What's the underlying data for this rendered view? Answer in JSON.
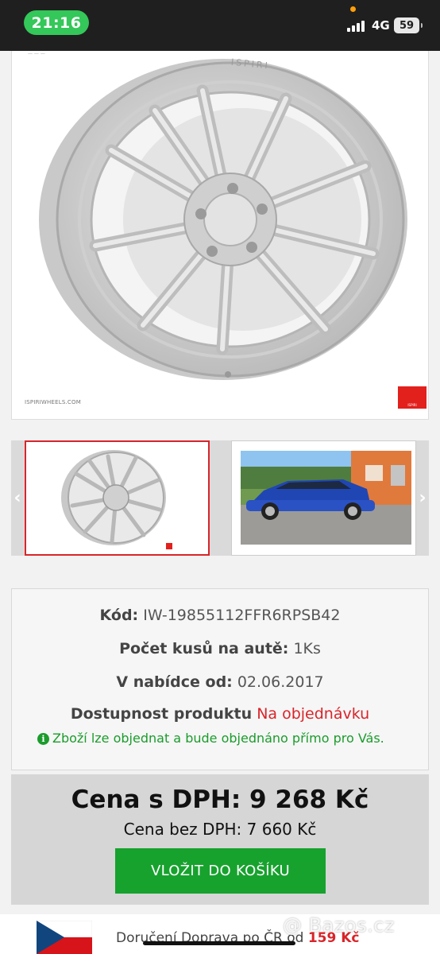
{
  "status": {
    "time": "21:16",
    "network": "4G",
    "battery": "59"
  },
  "product": {
    "image_brand_text": "ISPIRI",
    "image_url_text": "ISPIRIWHEELS.COM",
    "code_label": "Kód:",
    "code_value": "IW-19855112FFR6RPSB42",
    "count_label": "Počet kusů na autě:",
    "count_value": "1Ks",
    "offer_label": "V nabídce od:",
    "offer_value": "02.06.2017",
    "availability_label": "Dostupnost produktu",
    "availability_value": "Na objednávku",
    "note": "Zboží lze objednat a bude objednáno přímo pro Vás.",
    "price_with_vat": "Cena s DPH: 9 268 Kč",
    "price_without_vat": "Cena bez DPH: 7 660 Kč",
    "buy_button": "VLOŽIT DO KOŠÍKU"
  },
  "delivery": {
    "label": "Doručení Doprava po ČR od",
    "price": "159 Kč"
  },
  "watermark": "@ Bazos.cz",
  "colors": {
    "accent_red": "#d9252a",
    "buy_green": "#17a22e",
    "status_green": "#34c759"
  }
}
